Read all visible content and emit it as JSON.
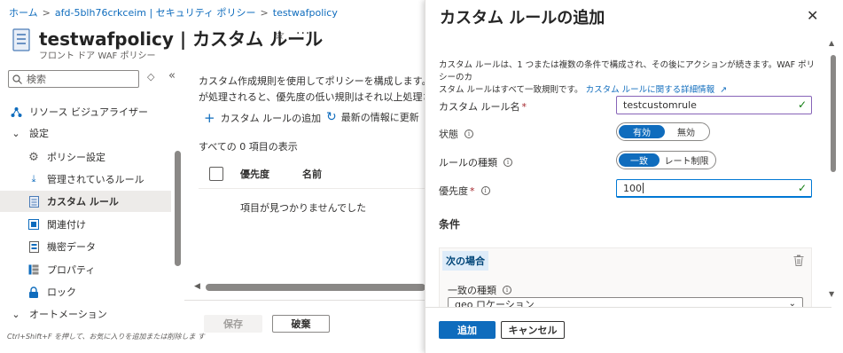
{
  "breadcrumb": {
    "items": [
      "ホーム",
      "afd-5blh76crkceim | セキュリティ ポリシー",
      "testwafpolicy"
    ],
    "separator": ">"
  },
  "header": {
    "title": "testwafpolicy | カスタム ルール",
    "subtitle": "フロント ドア WAF ポリシー"
  },
  "sidebar": {
    "search_placeholder": "検索",
    "items": [
      {
        "label": "リソース ビジュアライザー",
        "icon": "resource-visualizer-icon"
      },
      {
        "label": "設定",
        "icon": "chevron-down-icon"
      },
      {
        "label": "ポリシー設定",
        "icon": "gear-icon"
      },
      {
        "label": "管理されているルール",
        "icon": "download-icon"
      },
      {
        "label": "カスタム ルール",
        "icon": "document-icon",
        "selected": true
      },
      {
        "label": "関連付け",
        "icon": "link-icon"
      },
      {
        "label": "機密データ",
        "icon": "data-icon"
      },
      {
        "label": "プロパティ",
        "icon": "properties-icon"
      },
      {
        "label": "ロック",
        "icon": "lock-icon"
      },
      {
        "label": "オートメーション",
        "icon": "chevron-down-icon"
      }
    ],
    "hint": "Ctrl+Shift+F を押して、お気に入りを追加または削除しま す"
  },
  "main": {
    "description_line1": "カスタム作成規則を使用してポリシーを構成します。規",
    "description_line2": "が処理されると、優先度の低い規則はそれ以上処理され",
    "toolbar": {
      "add_label": "カスタム ルールの追加",
      "refresh_label": "最新の情報に更新"
    },
    "count_text": "すべての 0 項目の表示",
    "table": {
      "columns": [
        "優先度",
        "名前"
      ],
      "empty_text": "項目が見つかりませんでした"
    },
    "save_label": "保存",
    "discard_label": "破棄"
  },
  "panel": {
    "title": "カスタム ルールの追加",
    "description_line1": "カスタム ルールは、1 つまたは複数の条件で構成され、その後にアクションが続きます。WAF ポリシーのカ",
    "description_line2": "スタム ルールはすべて一致規則です。",
    "description_link": "カスタム ルールに関する詳細情報",
    "fields": {
      "rule_name_label": "カスタム ルール名",
      "rule_name_value": "testcustomrule",
      "status_label": "状態",
      "status_options": [
        "有効",
        "無効"
      ],
      "status_selected": "有効",
      "rule_type_label": "ルールの種類",
      "rule_type_options": [
        "一致",
        "レート制限"
      ],
      "rule_type_selected": "一致",
      "priority_label": "優先度",
      "priority_value": "100"
    },
    "conditions": {
      "heading": "条件",
      "if_label": "次の場合",
      "match_type_label": "一致の種類",
      "match_type_value": "geo ロケーション"
    },
    "add_label": "追加",
    "cancel_label": "キャンセル"
  },
  "colors": {
    "accent": "#0f6cbd",
    "selected_nav": "#edebe9",
    "input_border": "#8764b8",
    "valid_check": "#107c10",
    "required": "#a4262c"
  }
}
